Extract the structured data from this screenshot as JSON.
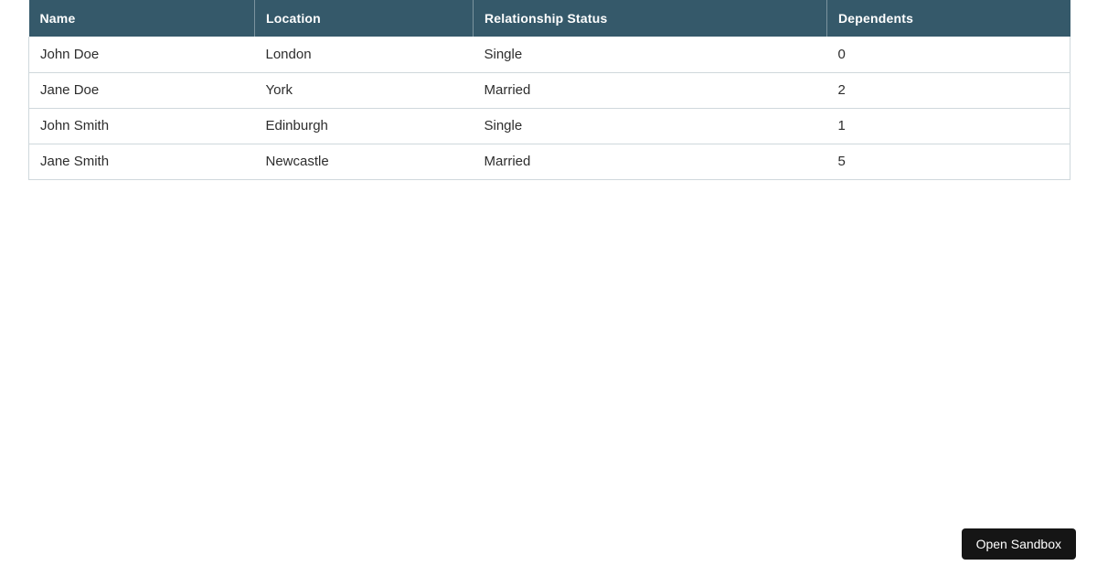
{
  "table": {
    "columns": [
      "Name",
      "Location",
      "Relationship Status",
      "Dependents"
    ],
    "rows": [
      [
        "John Doe",
        "London",
        "Single",
        "0"
      ],
      [
        "Jane Doe",
        "York",
        "Married",
        "2"
      ],
      [
        "John Smith",
        "Edinburgh",
        "Single",
        "1"
      ],
      [
        "Jane Smith",
        "Newcastle",
        "Married",
        "5"
      ]
    ]
  },
  "sandbox_button": {
    "label": "Open Sandbox"
  },
  "colors": {
    "header_bg": "#35596a",
    "header_text": "#ffffff",
    "header_divider": "rgba(255,255,255,0.35)",
    "row_border": "#cfd8dc",
    "body_text": "#2d2d2d",
    "button_bg": "#151515",
    "button_text": "#ffffff"
  }
}
